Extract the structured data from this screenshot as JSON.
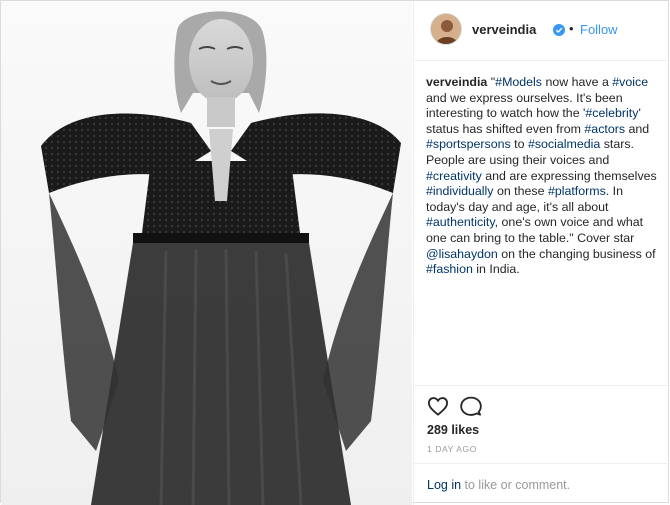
{
  "post": {
    "photo_icon": "fashion-photo",
    "header": {
      "username": "verveindia",
      "verified_icon": "verified-badge-icon",
      "separator": "•",
      "follow_label": "Follow"
    },
    "caption": {
      "username": "verveindia",
      "parts": [
        {
          "t": "\"",
          "tag": false
        },
        {
          "t": "#Models",
          "tag": true
        },
        {
          "t": " now have a ",
          "tag": false
        },
        {
          "t": "#voice",
          "tag": true
        },
        {
          "t": " and we express ourselves. It's been interesting to watch how the '",
          "tag": false
        },
        {
          "t": "#celebrity",
          "tag": true
        },
        {
          "t": "' status has shifted even from ",
          "tag": false
        },
        {
          "t": "#actors",
          "tag": true
        },
        {
          "t": " and ",
          "tag": false
        },
        {
          "t": "#sportspersons",
          "tag": true
        },
        {
          "t": " to ",
          "tag": false
        },
        {
          "t": "#socialmedia",
          "tag": true
        },
        {
          "t": " stars. People are using their voices and ",
          "tag": false
        },
        {
          "t": "#creativity",
          "tag": true
        },
        {
          "t": " and are expressing themselves ",
          "tag": false
        },
        {
          "t": "#individually",
          "tag": true
        },
        {
          "t": " on these ",
          "tag": false
        },
        {
          "t": "#platforms",
          "tag": true
        },
        {
          "t": ". In today's day and age, it's all about ",
          "tag": false
        },
        {
          "t": "#authenticity",
          "tag": true
        },
        {
          "t": ", one's own voice and what one can bring to the table.\" Cover star ",
          "tag": false
        },
        {
          "t": "@lisahaydon",
          "tag": true
        },
        {
          "t": " on the changing business of ",
          "tag": false
        },
        {
          "t": "#fashion",
          "tag": true
        },
        {
          "t": " in India.",
          "tag": false
        }
      ]
    },
    "actions": {
      "like_icon": "heart-icon",
      "comment_icon": "comment-icon"
    },
    "likes_text": "289 likes",
    "time_text": "1 DAY AGO",
    "add_comment": {
      "login_label": "Log in",
      "rest_label": " to like or comment."
    },
    "colors": {
      "link": "#003569",
      "follow": "#3897f0",
      "verified": "#3897f0",
      "muted": "#999999"
    }
  }
}
